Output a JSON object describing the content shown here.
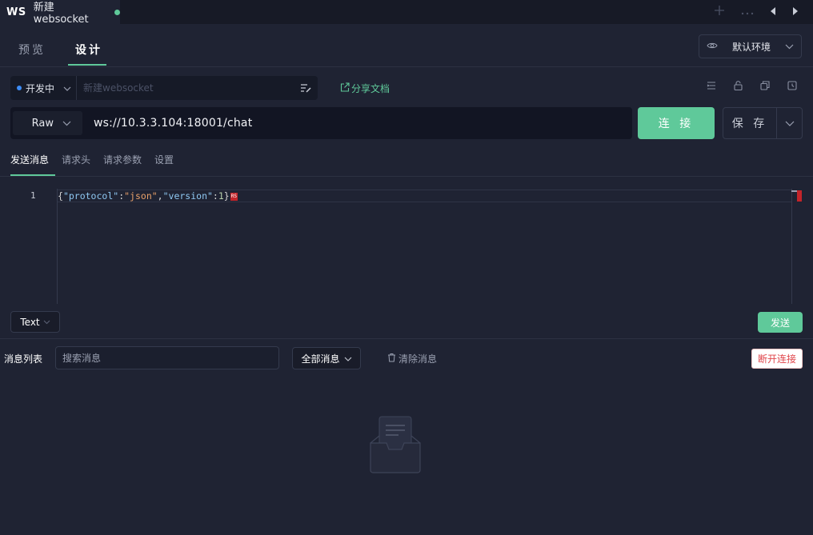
{
  "tab": {
    "badge": "WS",
    "title": "新建websocket",
    "status_color": "#5fc99a",
    "icons": [
      "plus-icon",
      "more-icon",
      "arrow-left-icon",
      "arrow-right-icon"
    ]
  },
  "mode_tabs": {
    "preview": "预览",
    "design": "设计",
    "active": "design"
  },
  "environment": {
    "icon": "eye-icon",
    "label": "默认环境"
  },
  "api": {
    "status_label": "开发中",
    "status_color": "#3d8cf5",
    "name_value": "",
    "name_placeholder": "新建websocket",
    "share_label": "分享文档",
    "toolbar_icons": [
      "outline-icon",
      "lock-icon",
      "copy-icon",
      "history-icon"
    ]
  },
  "request": {
    "method": "Raw",
    "url": "ws://10.3.3.104:18001/chat",
    "connect_label": "连 接",
    "save_label": "保 存"
  },
  "sub_tabs": [
    {
      "label": "发送消息",
      "active": true
    },
    {
      "label": "请求头",
      "active": false
    },
    {
      "label": "请求参数",
      "active": false
    },
    {
      "label": "设置",
      "active": false
    }
  ],
  "editor": {
    "line_number": "1",
    "tokens": [
      "{",
      "\"protocol\"",
      ":",
      "\"json\"",
      ",",
      "\"version\"",
      ":",
      "1",
      "}"
    ],
    "rs_marker": "RS"
  },
  "send": {
    "format": "Text",
    "send_label": "发送"
  },
  "messages": {
    "title": "消息列表",
    "search_placeholder": "搜索消息",
    "filter_label": "全部消息",
    "clear_label": "清除消息",
    "disconnect_label": "断开连接",
    "accent_color": "#5fc99a",
    "danger_color": "#e0454b"
  }
}
